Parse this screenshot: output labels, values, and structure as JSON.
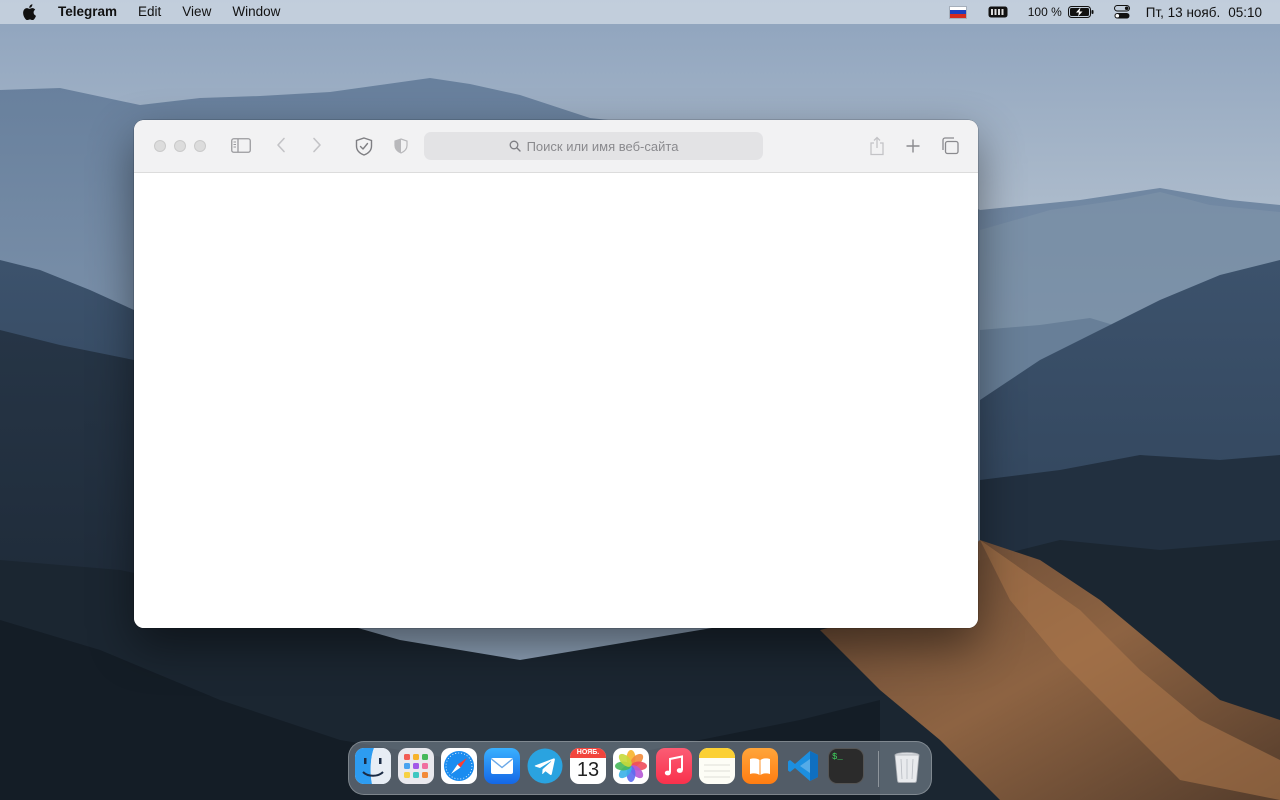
{
  "menubar": {
    "app_name": "Telegram",
    "menus": [
      "Edit",
      "View",
      "Window"
    ],
    "battery_percent": "100 %",
    "day_date": "Пт, 13 нояб.",
    "time": "05:10",
    "icons": [
      "apple-logo-icon",
      "russian-flag-icon",
      "keyboard-input-icon",
      "battery-charging-icon",
      "control-center-icon"
    ]
  },
  "safari": {
    "address_placeholder": "Поиск или имя веб-сайта",
    "toolbar_icons": [
      "sidebar-icon",
      "back-arrow-icon",
      "forward-arrow-icon",
      "privacy-shield-icon",
      "half-shield-icon",
      "share-icon",
      "new-tab-plus-icon",
      "tabs-overview-icon"
    ]
  },
  "dock": {
    "apps": [
      "Finder",
      "Launchpad",
      "Safari",
      "Mail",
      "Telegram",
      "Calendar",
      "Photos",
      "Music",
      "Notes",
      "Books",
      "Visual Studio Code",
      "Terminal",
      "Trash"
    ],
    "calendar": {
      "month": "НОЯБ.",
      "day": "13"
    },
    "terminal_text": "$_"
  },
  "colors": {
    "menubar_bg": "#d6dee8",
    "window_toolbar": "#f2f2f3",
    "address_bar": "#e3e3e5"
  }
}
